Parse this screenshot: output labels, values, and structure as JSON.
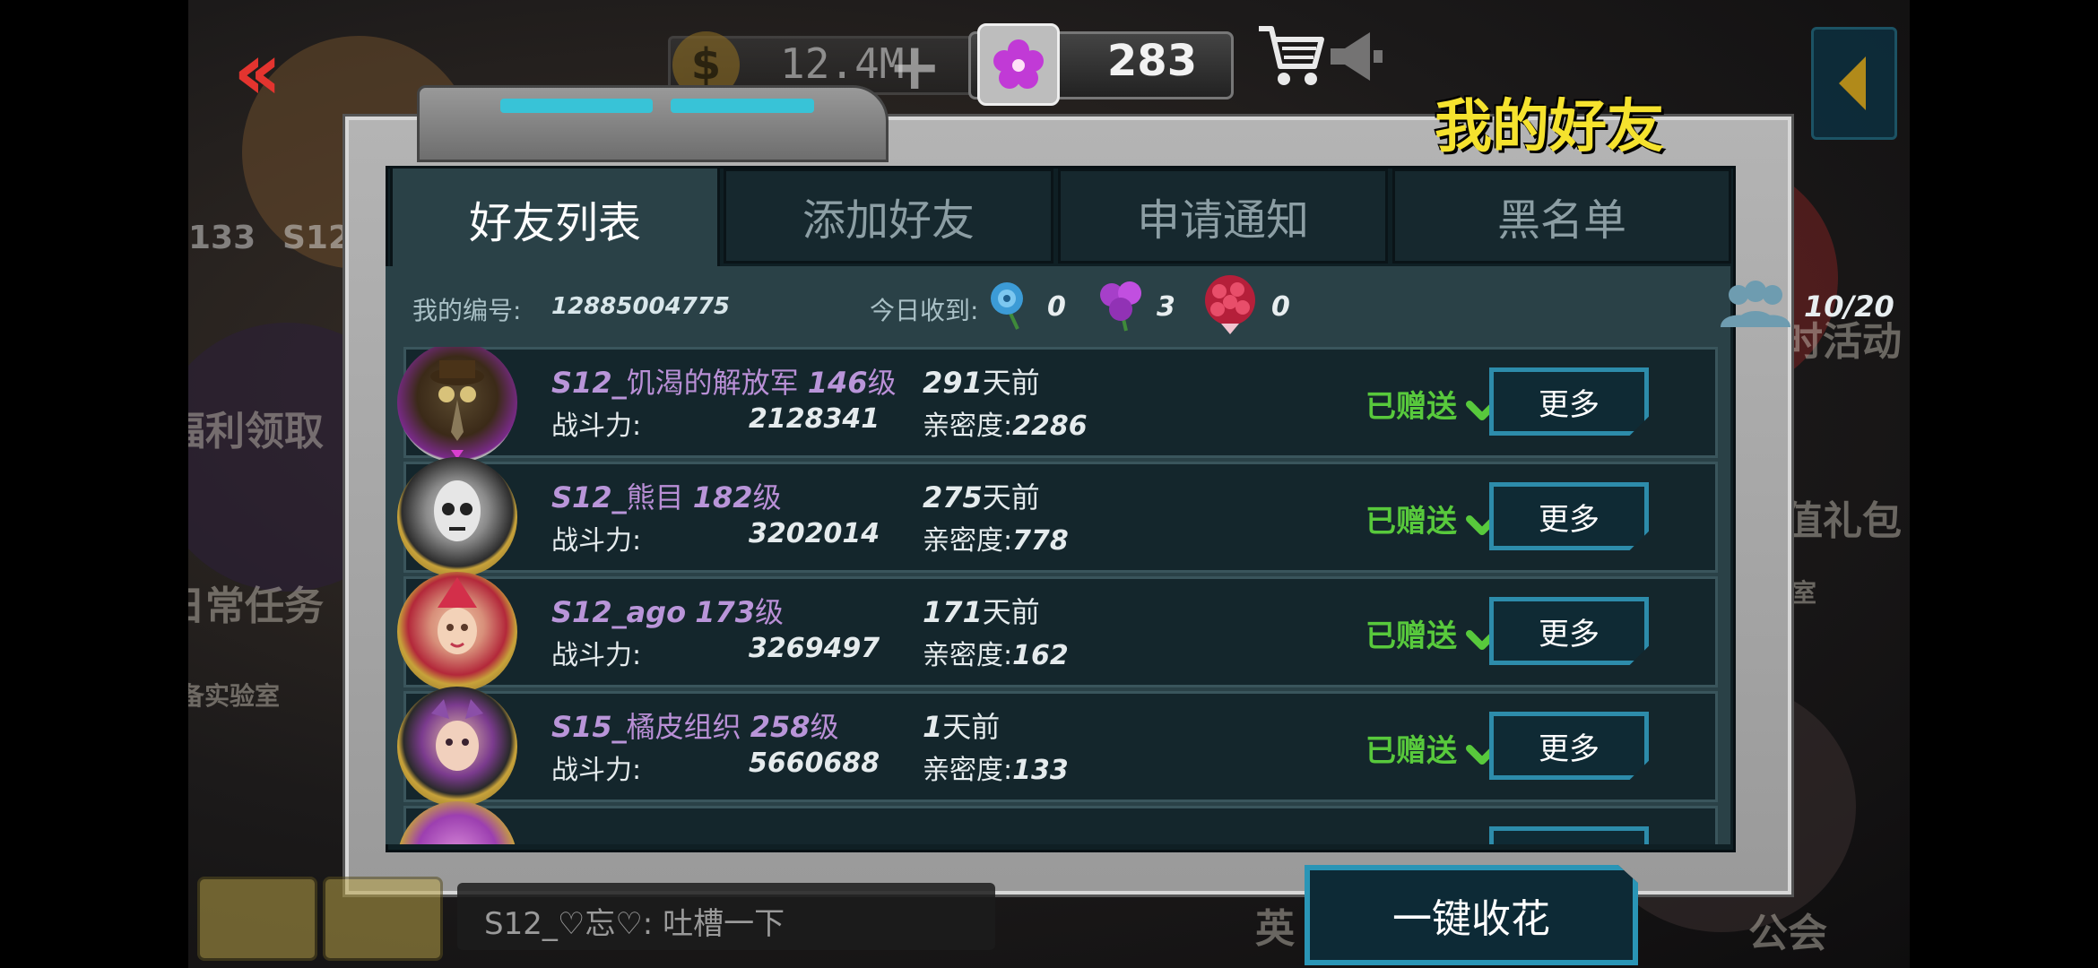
{
  "topbar": {
    "back_icon": "double-chevron-left-icon",
    "coins": "12.4M",
    "gems": "283"
  },
  "panel": {
    "title": "我的好友",
    "tabs": [
      {
        "label": "好友列表",
        "active": true
      },
      {
        "label": "添加好友",
        "active": false
      },
      {
        "label": "申请通知",
        "active": false
      },
      {
        "label": "黑名单",
        "active": false
      }
    ]
  },
  "info": {
    "id_label": "我的编号:",
    "id_value": "12885004775",
    "received_label": "今日收到:",
    "blue_count": "0",
    "purple_count": "3",
    "red_count": "0",
    "friends_count": "10/20"
  },
  "friends": [
    {
      "prefix": "S12_",
      "name": "饥渴的解放军",
      "level": "146",
      "level_unit": "级",
      "power_label": "战斗力:",
      "power": "2128341",
      "days": "291",
      "days_unit": "天前",
      "intimacy_label": "亲密度:",
      "intimacy": "2286",
      "status": "已赠送",
      "more": "更多"
    },
    {
      "prefix": "S12_",
      "name": "熊目",
      "level": "182",
      "level_unit": "级",
      "power_label": "战斗力:",
      "power": "3202014",
      "days": "275",
      "days_unit": "天前",
      "intimacy_label": "亲密度:",
      "intimacy": "778",
      "status": "已赠送",
      "more": "更多"
    },
    {
      "prefix": "S12_ago",
      "name": "",
      "level": "173",
      "level_unit": "级",
      "power_label": "战斗力:",
      "power": "3269497",
      "days": "171",
      "days_unit": "天前",
      "intimacy_label": "亲密度:",
      "intimacy": "162",
      "status": "已赠送",
      "more": "更多"
    },
    {
      "prefix": "S15_",
      "name": "橘皮组织",
      "level": "258",
      "level_unit": "级",
      "power_label": "战斗力:",
      "power": "5660688",
      "days": "1",
      "days_unit": "天前",
      "intimacy_label": "亲密度:",
      "intimacy": "133",
      "status": "已赠送",
      "more": "更多"
    }
  ],
  "bottom": {
    "collect_button": "一键收花",
    "chat_preview": "S12_♡忘♡: 吐槽一下"
  },
  "background": {
    "badge_num": "133",
    "badge_server": "S12",
    "left_items": [
      "福利领取",
      "日常任务",
      "备实验室"
    ],
    "right_items": [
      "限时活动",
      "超值礼包",
      "验室"
    ],
    "bottom_items": [
      "英",
      "公会"
    ]
  },
  "colors": {
    "accent_teal": "#2a95b6",
    "title_yellow": "#f5e22e",
    "sent_green": "#58c93c",
    "name_purple": "#b98fd6"
  }
}
